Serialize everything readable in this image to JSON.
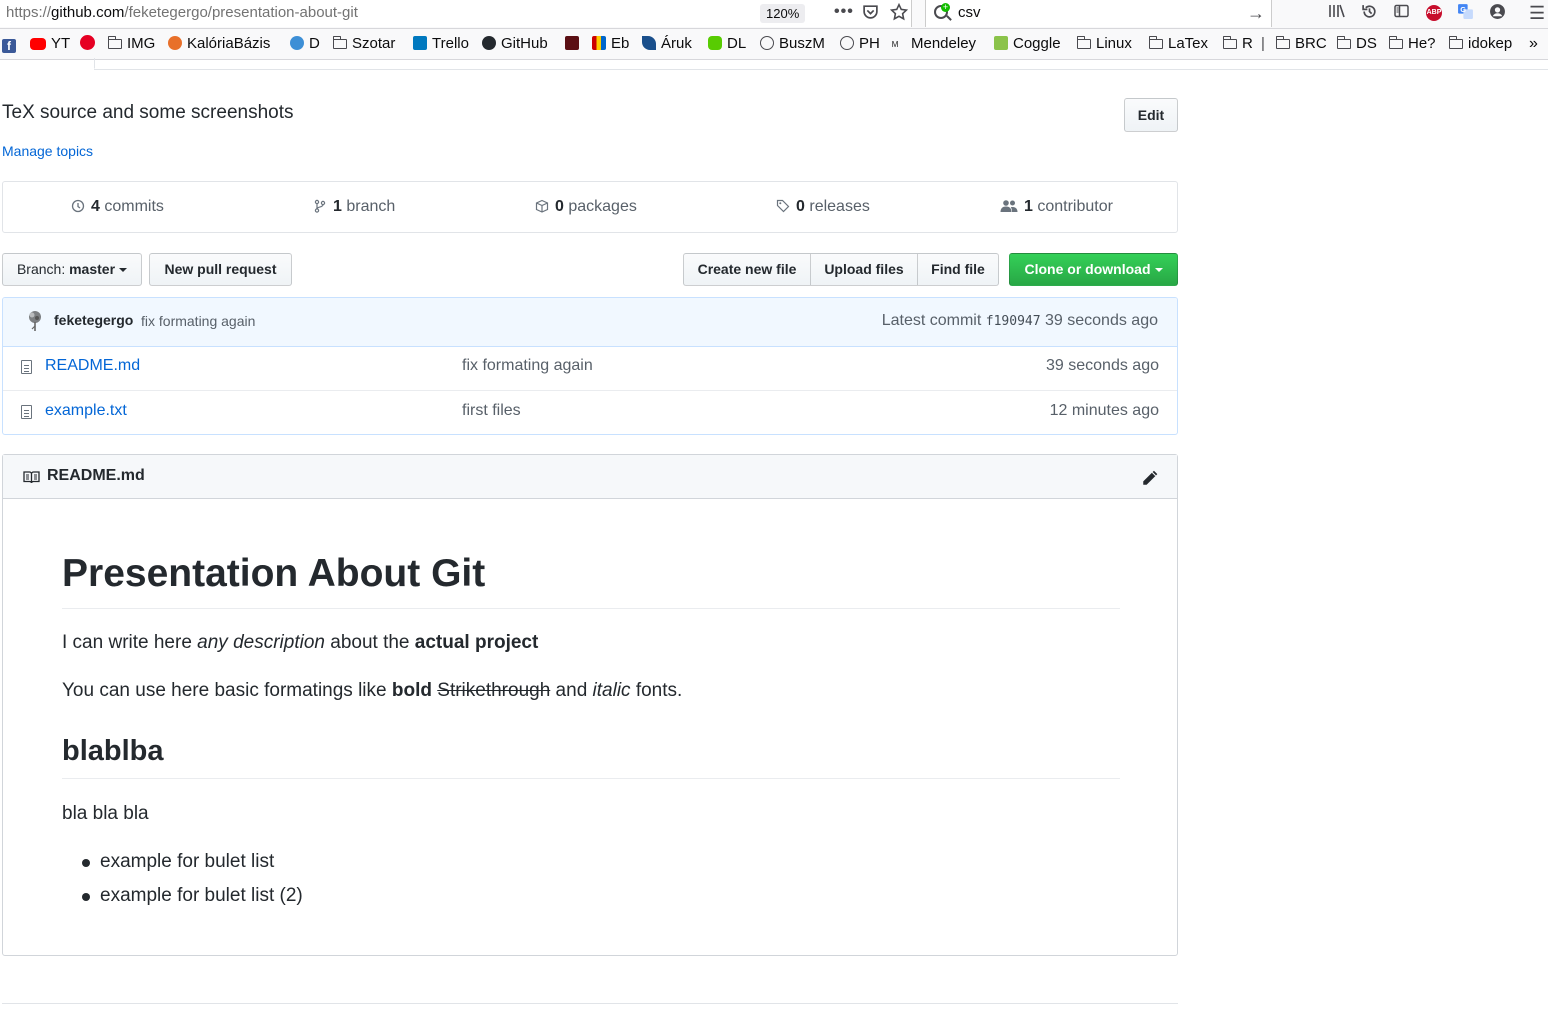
{
  "browser": {
    "url_prefix": "https://",
    "url_host": "github.com",
    "url_path": "/feketegergo/presentation-about-git",
    "zoom": "120%",
    "search_value": "csv",
    "bookmarks": [
      "YT",
      "IMG",
      "KalóriaBázis",
      "D",
      "Szotar",
      "Trello",
      "GitHub",
      "Eb",
      "Áruk",
      "DL",
      "BuszM",
      "PH",
      "Mendeley",
      "Coggle",
      "Linux",
      "LaTex",
      "R",
      "BRC",
      "DS",
      "He?",
      "idokep"
    ]
  },
  "repo": {
    "description": "TeX source and some screenshots",
    "manage_topics": "Manage topics",
    "edit_label": "Edit",
    "stats": {
      "commits_count": "4",
      "commits_label": "commits",
      "branches_count": "1",
      "branches_label": "branch",
      "packages_count": "0",
      "packages_label": "packages",
      "releases_count": "0",
      "releases_label": "releases",
      "contributors_count": "1",
      "contributors_label": "contributor"
    },
    "branch_prefix": "Branch:",
    "branch_name": "master",
    "new_pr_label": "New pull request",
    "create_file_label": "Create new file",
    "upload_label": "Upload files",
    "find_file_label": "Find file",
    "clone_label": "Clone or download"
  },
  "commit": {
    "author": "feketegergo",
    "message": "fix formating again",
    "latest_label": "Latest commit",
    "sha": "f190947",
    "age": "39 seconds ago"
  },
  "files": [
    {
      "name": "README.md",
      "message": "fix formating again",
      "age": "39 seconds ago"
    },
    {
      "name": "example.txt",
      "message": "first files",
      "age": "12 minutes ago"
    }
  ],
  "readme": {
    "title": "README.md",
    "h1": "Presentation About Git",
    "p1_a": "I can write here ",
    "p1_em": "any description",
    "p1_b": " about the ",
    "p1_strong": "actual project",
    "p2_a": "You can use here basic formatings like ",
    "p2_strong": "bold",
    "p2_b": " ",
    "p2_del": "Strikethrough",
    "p2_c": " and ",
    "p2_em": "italic",
    "p2_d": " fonts.",
    "h2": "blablba",
    "p3": "bla bla bla",
    "list": [
      "example for bulet list",
      "example for bulet list (2)"
    ]
  },
  "colors": {
    "link": "#0366d6",
    "clone_green": "#28a745",
    "commit_bar_bg": "#f1f8ff"
  }
}
